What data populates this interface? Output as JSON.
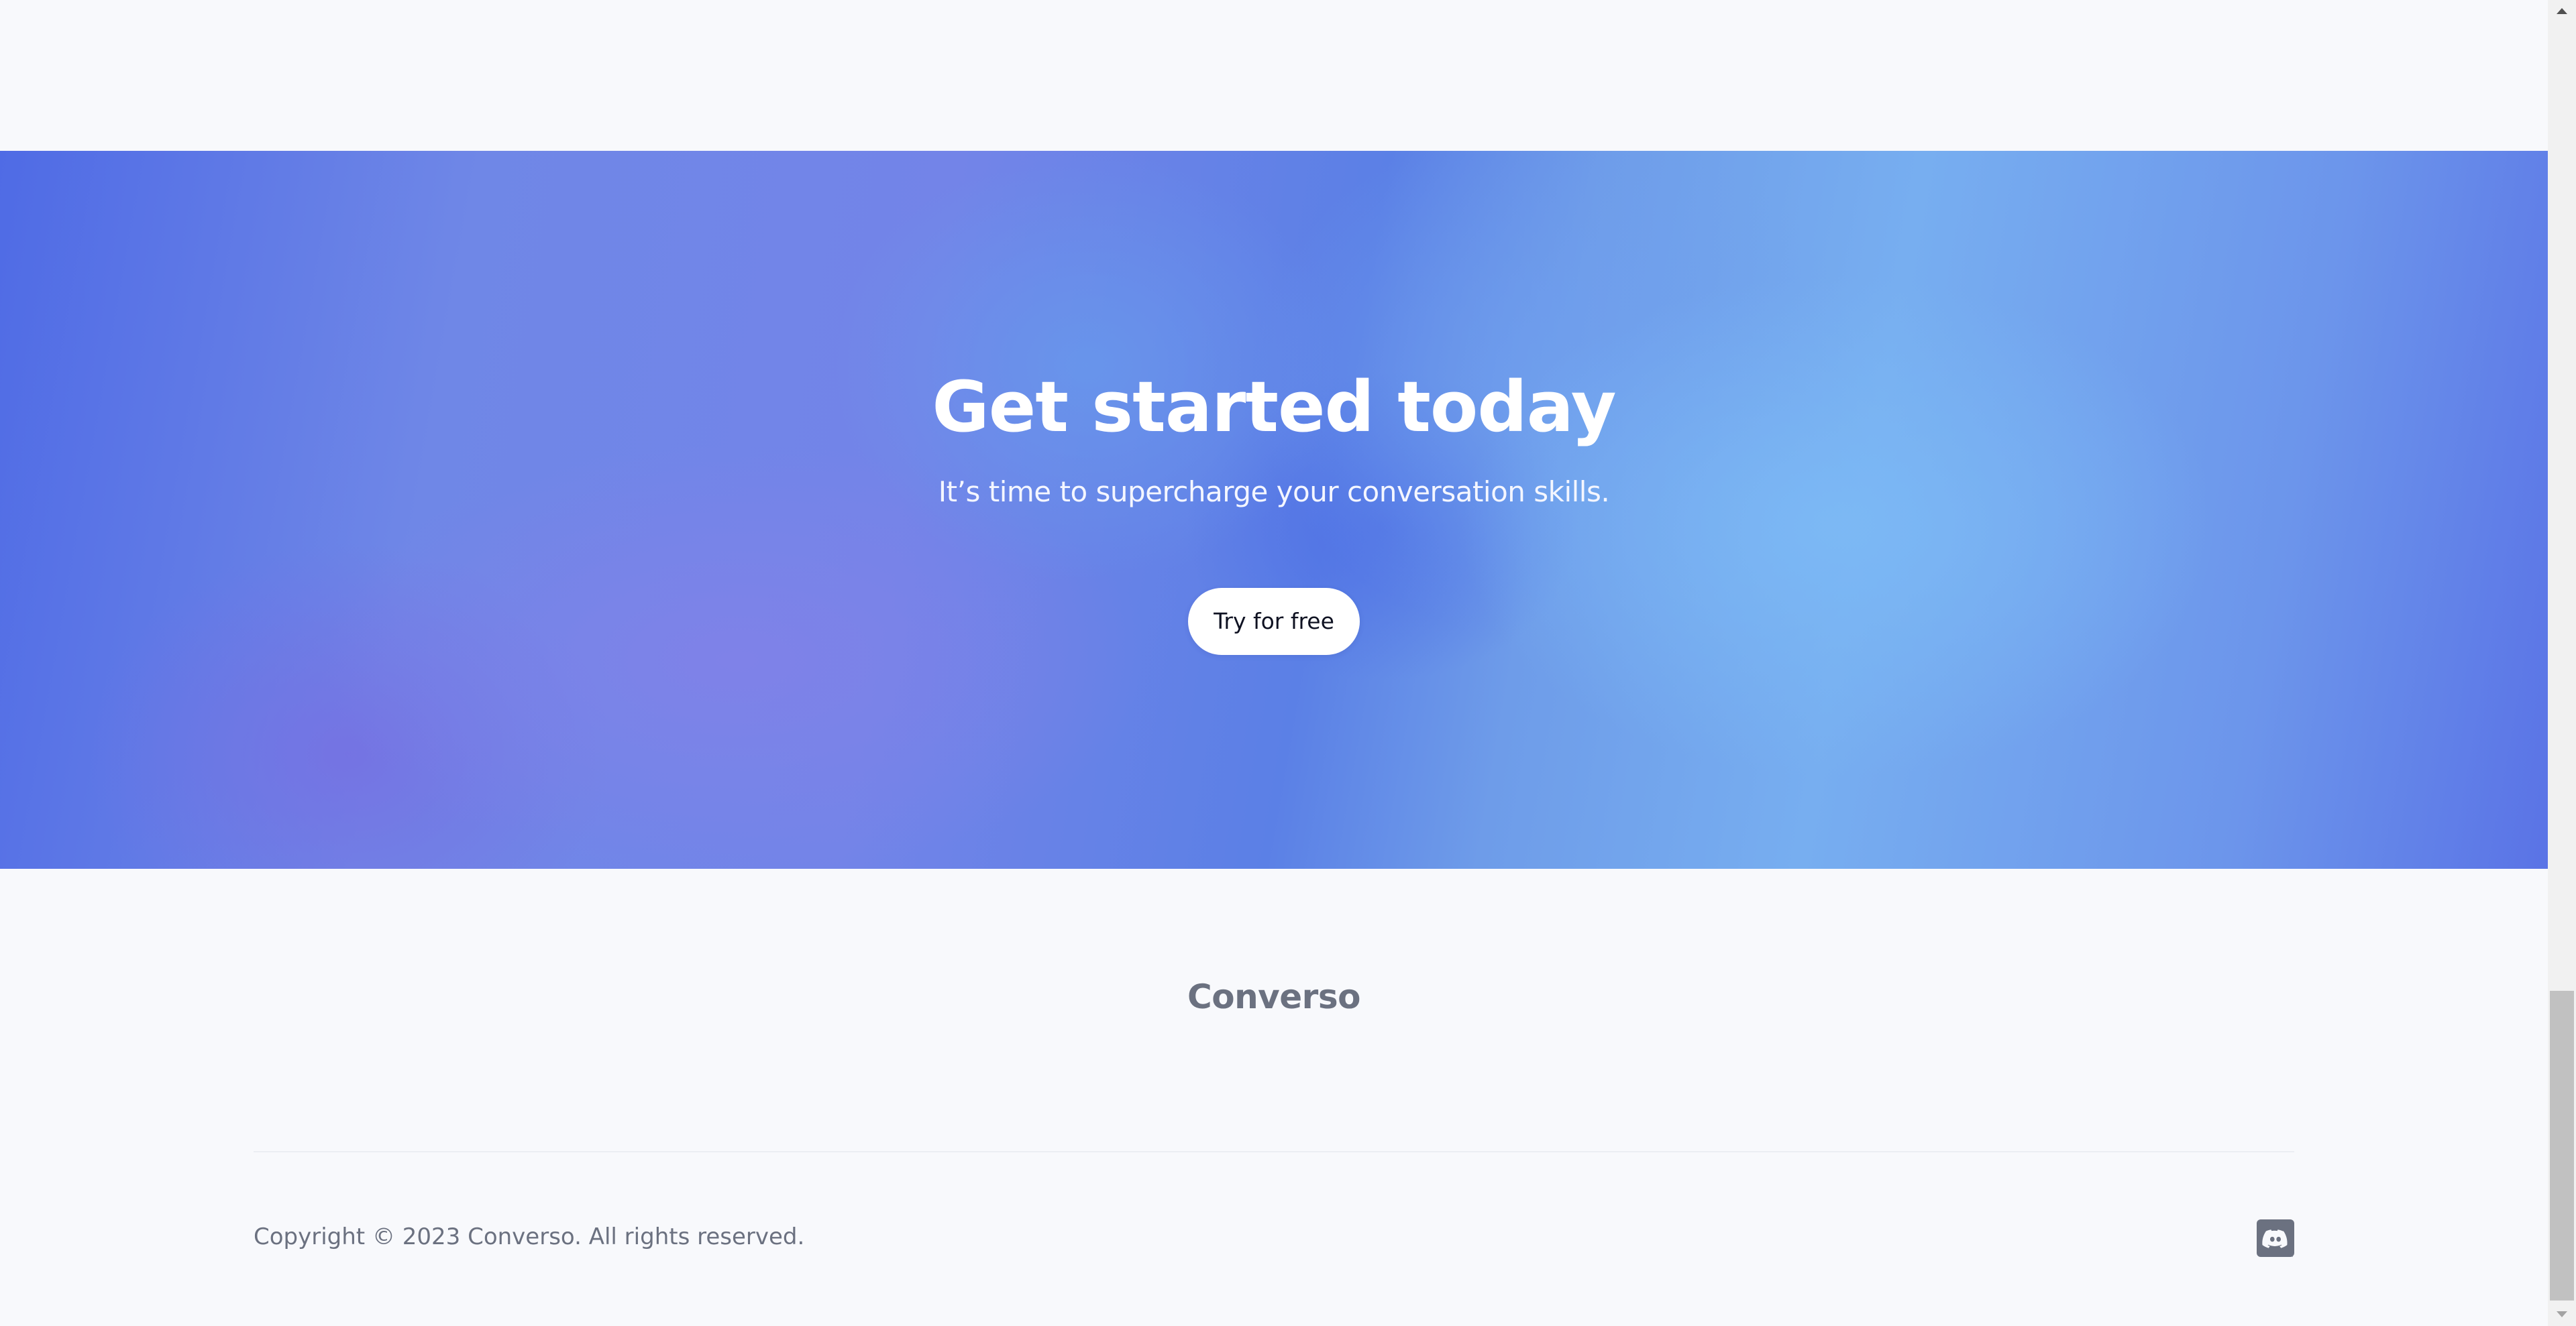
{
  "hero": {
    "title": "Get started today",
    "subtitle": "It’s time to supercharge your conversation skills.",
    "cta_label": "Try for free"
  },
  "footer": {
    "logo_text": "Converso",
    "copyright": "Copyright © 2023 Converso. All rights reserved.",
    "social": [
      {
        "icon": "discord-icon"
      }
    ]
  },
  "colors": {
    "page_background": "#f8f9fc",
    "hero_primary": "#4f6be5",
    "hero_light": "#77aef0",
    "hero_violet": "#7e80e8",
    "button_background": "#ffffff",
    "muted_text": "#6b7180"
  },
  "scrollbar": {
    "scroll_position_percent": 100
  }
}
